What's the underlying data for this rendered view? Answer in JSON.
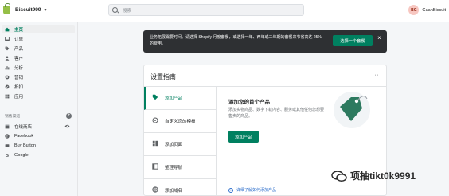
{
  "app": {
    "store_name": "Biscuit999",
    "search_placeholder": "搜索",
    "user": {
      "initials": "BG",
      "name": "GuanBiscuit"
    }
  },
  "sidebar": {
    "items": [
      {
        "label": "主页",
        "icon": "home-icon",
        "active": true
      },
      {
        "label": "订单",
        "icon": "orders-icon"
      },
      {
        "label": "产品",
        "icon": "tag-icon"
      },
      {
        "label": "客户",
        "icon": "person-icon"
      },
      {
        "label": "分析",
        "icon": "bar-chart-icon"
      },
      {
        "label": "营销",
        "icon": "megaphone-icon"
      },
      {
        "label": "折扣",
        "icon": "discount-icon"
      },
      {
        "label": "应用",
        "icon": "apps-icon"
      }
    ],
    "channels_title": "销售渠道",
    "channels": [
      {
        "label": "在线商店",
        "icon": "store-icon"
      },
      {
        "label": "Facebook",
        "icon": "facebook-icon"
      },
      {
        "label": "Buy Button",
        "icon": "buy-button-icon"
      },
      {
        "label": "Google",
        "icon": "google-icon"
      }
    ]
  },
  "banner": {
    "text": "业务拓展需要时间。请选择 Shopify 月度套餐，或选择一年、两年或三年期的套餐来节省高达 25% 的费用。",
    "button": "选择一个套餐"
  },
  "setup_guide": {
    "title": "设置指南",
    "more": "···",
    "tabs": [
      {
        "label": "添加产品",
        "icon": "tag-icon",
        "active": true
      },
      {
        "label": "自定义您的模板",
        "icon": "brush-icon"
      },
      {
        "label": "添加页面",
        "icon": "pages-icon"
      },
      {
        "label": "整理导航",
        "icon": "navigation-icon"
      },
      {
        "label": "添加域名",
        "icon": "globe-icon"
      }
    ],
    "content": {
      "title": "添加您的首个产品",
      "description": "添加实物商品、数字下载内容、服务或其他任何您想要售卖的商品。",
      "button": "添加产品",
      "link": "详细了解如何添加产品"
    }
  },
  "watermark": {
    "text": "项抽tikt0k9991"
  },
  "colors": {
    "accent": "#008060",
    "banner_bg": "#2e3033",
    "link": "#2c6ecb"
  }
}
